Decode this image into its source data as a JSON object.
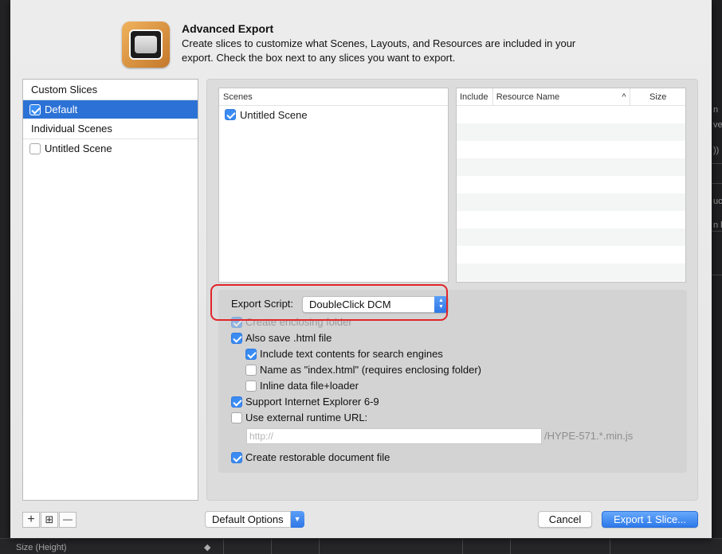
{
  "dialog": {
    "title": "Advanced Export",
    "description": "Create slices to customize what Scenes, Layouts, and Resources are included in your export. Check the box next to any slices you want to export."
  },
  "left_list": {
    "custom_header": "Custom Slices",
    "custom_items": [
      {
        "label": "Default",
        "checked": true,
        "selected": true
      }
    ],
    "individual_header": "Individual Scenes",
    "individual_items": [
      {
        "label": "Untitled Scene",
        "checked": false
      }
    ]
  },
  "scenes": {
    "header": "Scenes",
    "items": [
      {
        "label": "Untitled Scene",
        "checked": true
      }
    ]
  },
  "resources": {
    "columns": [
      "Include",
      "Resource Name",
      "Size"
    ],
    "sort_indicator": "^"
  },
  "options": {
    "export_script_label": "Export Script:",
    "export_script_value": "DoubleClick DCM",
    "create_enclosing_folder": "Create enclosing folder",
    "also_save_html": "Also save .html file",
    "include_text": "Include text contents for search engines",
    "name_as_index": "Name as \"index.html\" (requires enclosing folder)",
    "inline_data": "Inline data file+loader",
    "support_ie": "Support Internet Explorer 6-9",
    "use_external_runtime": "Use external runtime URL:",
    "runtime_url_placeholder": "http://",
    "runtime_url_suffix": "/HYPE-571.*.min.js",
    "create_restorable": "Create restorable document file"
  },
  "buttons": {
    "add": "+",
    "duplicate": "⊞",
    "remove": "—",
    "default_options": "Default Options",
    "cancel": "Cancel",
    "export": "Export 1 Slice..."
  },
  "background": {
    "bottom_label": "Size (Height)",
    "right_snippets": [
      "n",
      "ve",
      "))",
      "uc",
      "n l"
    ]
  },
  "colors": {
    "accent": "#2c72d6",
    "highlight_ring": "#e0262a"
  }
}
